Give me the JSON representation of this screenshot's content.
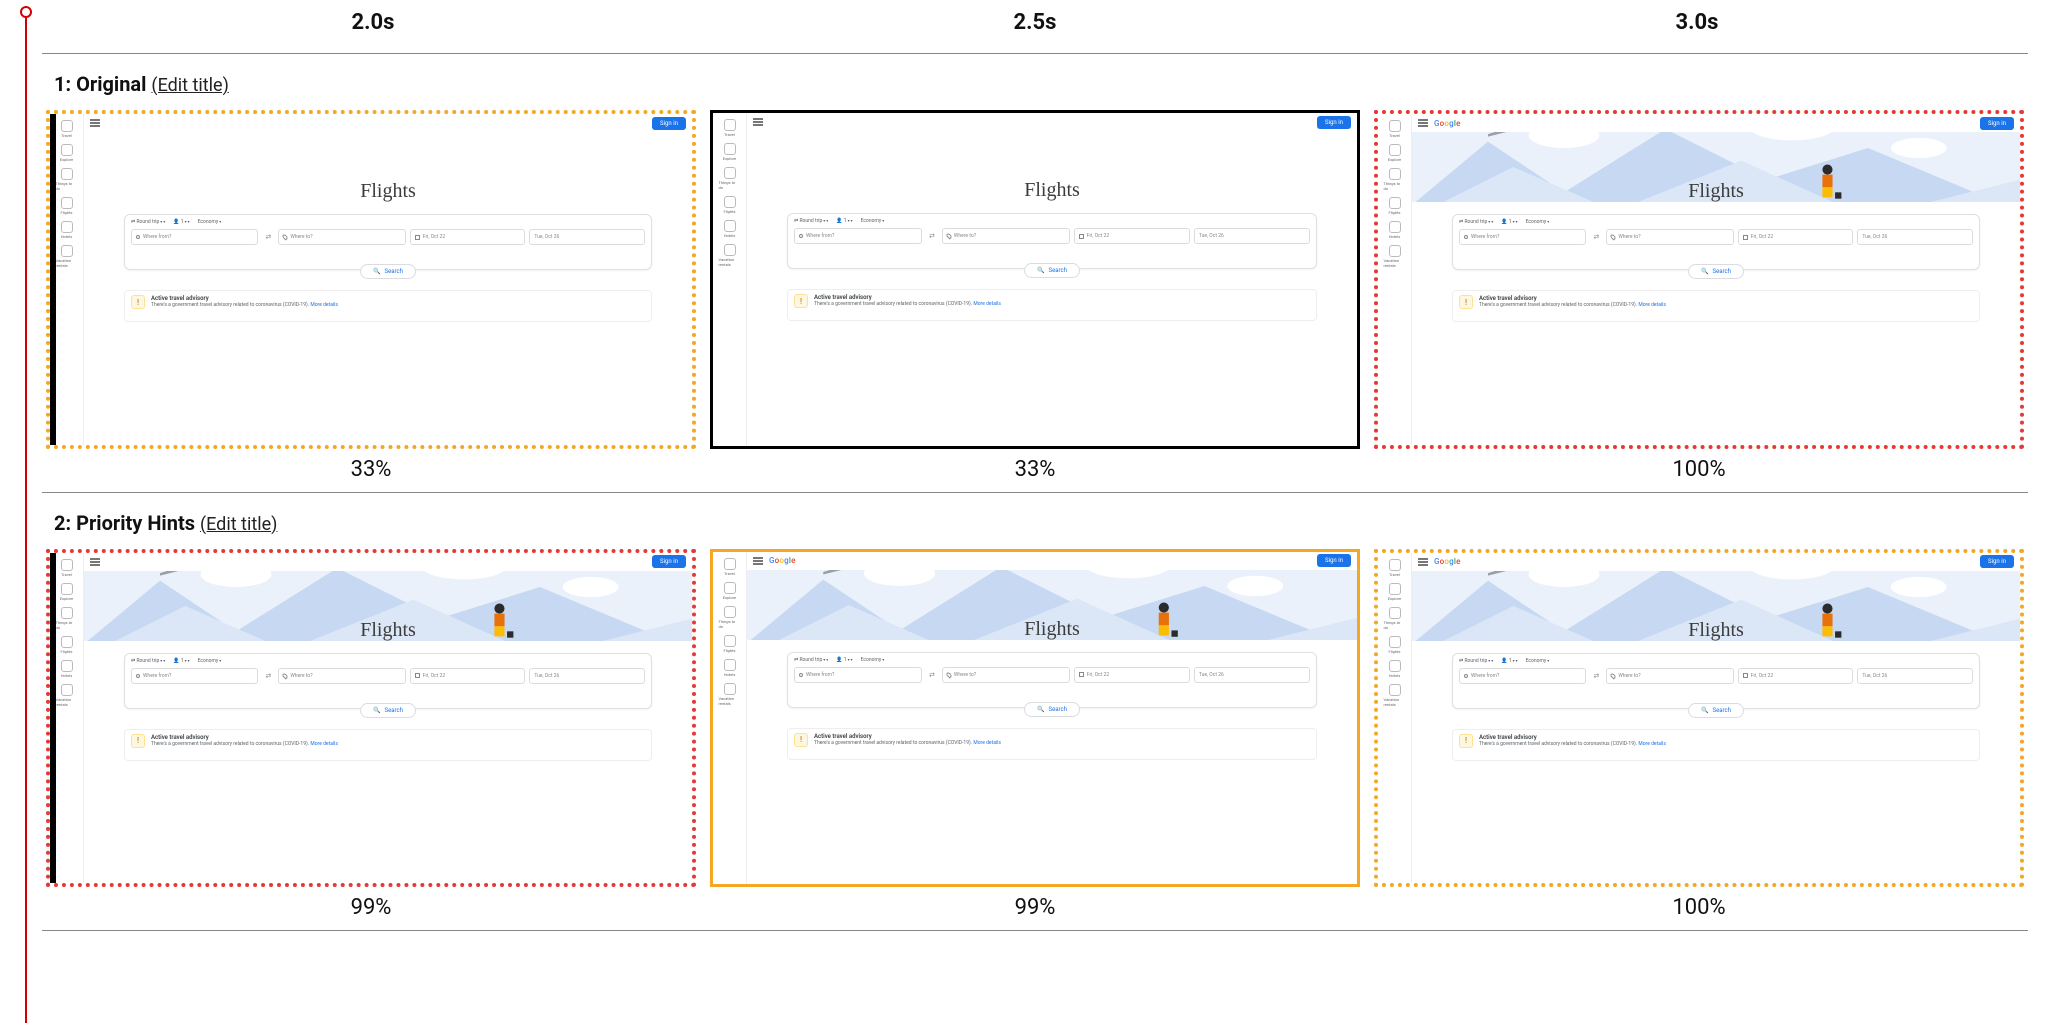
{
  "time_labels": [
    "2.0s",
    "2.5s",
    "3.0s"
  ],
  "edit_title_label": "(Edit title)",
  "rows": [
    {
      "index": "1",
      "name": "Original",
      "frames": [
        {
          "pct": "33%",
          "border": "border-dotted-orange",
          "left_accent": true,
          "hero": false,
          "logo": false
        },
        {
          "pct": "33%",
          "border": "border-solid-black",
          "left_accent": false,
          "hero": false,
          "logo": false
        },
        {
          "pct": "100%",
          "border": "border-dotted-red",
          "left_accent": false,
          "hero": true,
          "logo": true
        }
      ]
    },
    {
      "index": "2",
      "name": "Priority Hints",
      "frames": [
        {
          "pct": "99%",
          "border": "border-dotted-red",
          "left_accent": true,
          "hero": true,
          "logo": false
        },
        {
          "pct": "99%",
          "border": "border-solid-orange",
          "left_accent": false,
          "hero": true,
          "logo": true
        },
        {
          "pct": "100%",
          "border": "border-dotted-orange",
          "left_accent": false,
          "hero": true,
          "logo": true
        }
      ]
    }
  ],
  "gf": {
    "signin": "Sign in",
    "title": "Flights",
    "tabs": {
      "trip": "Round trip",
      "pax": "1",
      "class": "Economy"
    },
    "fields": {
      "from_ph": "Where from?",
      "to_ph": "Where to?",
      "date1": "Fri, Oct 22",
      "date2": "Tue, Oct 26"
    },
    "search": "Search",
    "advisory": {
      "title": "Active travel advisory",
      "body": "There's a government travel advisory related to coronavirus (COVID-19).",
      "more": "More details"
    },
    "sidebar_items": [
      "Travel",
      "Explore",
      "Things to do",
      "Flights",
      "Hotels",
      "Vacation rentals"
    ],
    "logo_letters": [
      "G",
      "o",
      "o",
      "g",
      "l",
      "e"
    ]
  }
}
